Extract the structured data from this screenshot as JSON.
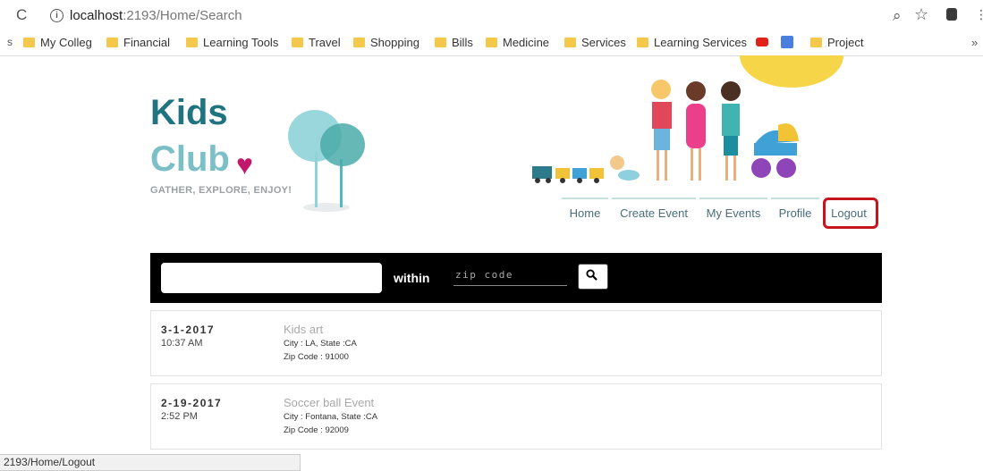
{
  "browser": {
    "url_host": "localhost",
    "url_path": ":2193/Home/Search",
    "reload_icon": "reload-icon",
    "status_text": "2193/Home/Logout"
  },
  "bookmarks": {
    "leading": "s",
    "items": [
      {
        "label": "My Colleg"
      },
      {
        "label": "Financial"
      },
      {
        "label": "Learning Tools"
      },
      {
        "label": "Travel"
      },
      {
        "label": "Shopping"
      },
      {
        "label": "Bills"
      },
      {
        "label": "Medicine"
      },
      {
        "label": "Services"
      },
      {
        "label": "Learning Services"
      },
      {
        "label": "Project"
      }
    ],
    "overflow": "»"
  },
  "site": {
    "logo_line1": "Kids",
    "logo_line2": "Club",
    "tagline": "GATHER, EXPLORE, ENJOY!",
    "colors": {
      "logo_dark": "#1f7480",
      "logo_light": "#7bbfc7",
      "heart": "#c2186b",
      "highlight": "#c7151e"
    }
  },
  "nav": {
    "items": [
      {
        "label": "Home"
      },
      {
        "label": "Create Event"
      },
      {
        "label": "My Events"
      },
      {
        "label": "Profile"
      },
      {
        "label": "Logout"
      }
    ]
  },
  "search": {
    "query_value": "",
    "within_label": "within",
    "zip_placeholder": "zip code"
  },
  "events": [
    {
      "date": "3-1-2017",
      "time": "10:37 AM",
      "title": "Kids art",
      "location": "City : LA, State :CA",
      "zip": "Zip Code : 91000"
    },
    {
      "date": "2-19-2017",
      "time": "2:52 PM",
      "title": "Soccer ball Event",
      "location": "City : Fontana, State :CA",
      "zip": "Zip Code : 92009"
    }
  ]
}
